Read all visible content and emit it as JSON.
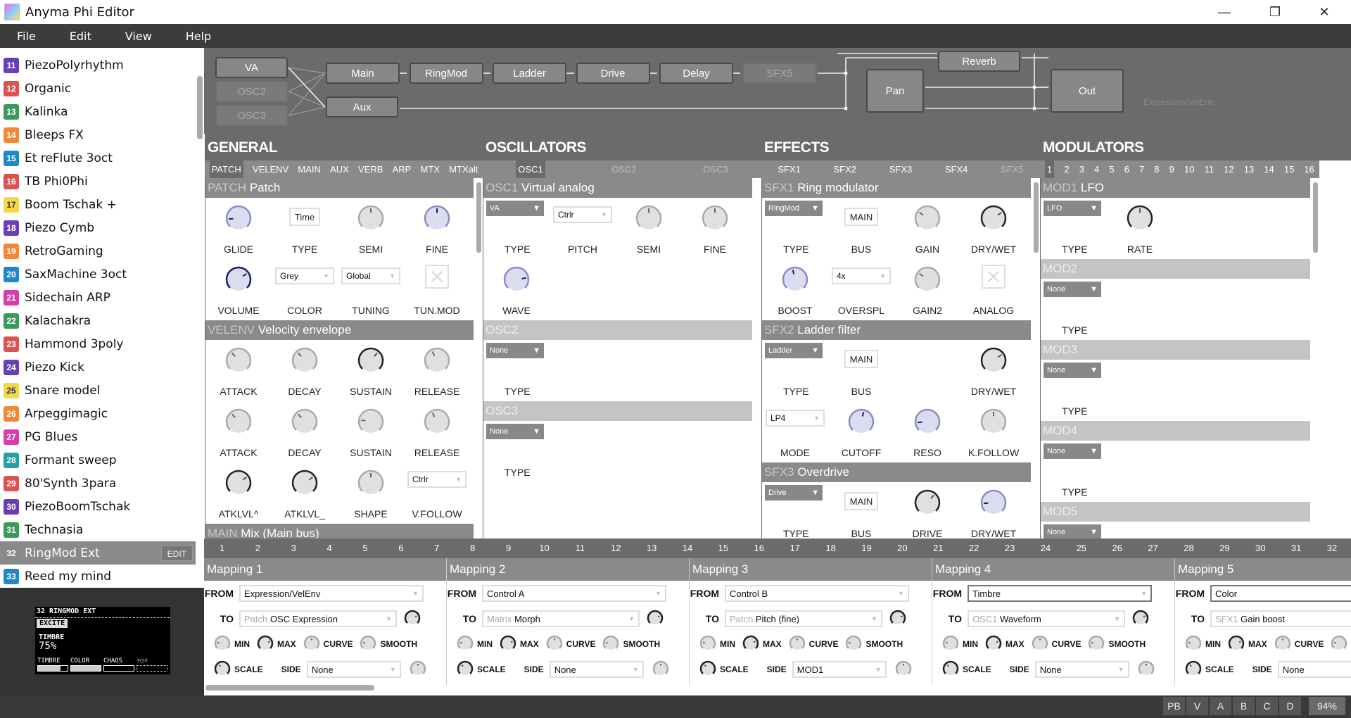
{
  "window": {
    "title": "Anyma Phi Editor",
    "controls": [
      "minimize-icon",
      "restore-icon",
      "close-icon"
    ]
  },
  "menu": [
    "File",
    "Edit",
    "View",
    "Help"
  ],
  "patches": [
    {
      "num": "11",
      "name": "PiezoPolyrhythm",
      "color": "#6a3fb5"
    },
    {
      "num": "12",
      "name": "Organic",
      "color": "#d9534f"
    },
    {
      "num": "13",
      "name": "Kalinka",
      "color": "#3a9a5b"
    },
    {
      "num": "14",
      "name": "Bleeps FX",
      "color": "#f0883a"
    },
    {
      "num": "15",
      "name": "Et reFlute 3oct",
      "color": "#1e88c8"
    },
    {
      "num": "16",
      "name": "TB Phi0Phi",
      "color": "#d9534f"
    },
    {
      "num": "17",
      "name": "Boom Tschak +",
      "color": "#f3d94a"
    },
    {
      "num": "18",
      "name": "Piezo Cymb",
      "color": "#6a3fb5"
    },
    {
      "num": "19",
      "name": "RetroGaming",
      "color": "#f0883a"
    },
    {
      "num": "20",
      "name": "SaxMachine 3oct",
      "color": "#1e88c8"
    },
    {
      "num": "21",
      "name": "Sidechain ARP",
      "color": "#d63fa8"
    },
    {
      "num": "22",
      "name": "Kalachakra",
      "color": "#3a9a5b"
    },
    {
      "num": "23",
      "name": "Hammond 3poly",
      "color": "#d9534f"
    },
    {
      "num": "24",
      "name": "Piezo Kick",
      "color": "#6a3fb5"
    },
    {
      "num": "25",
      "name": "Snare model",
      "color": "#f3d94a"
    },
    {
      "num": "26",
      "name": "Arpeggimagic",
      "color": "#f0883a"
    },
    {
      "num": "27",
      "name": "PG Blues",
      "color": "#d63fa8"
    },
    {
      "num": "28",
      "name": "Formant sweep",
      "color": "#24a0a6"
    },
    {
      "num": "29",
      "name": "80'Synth 3para",
      "color": "#d9534f"
    },
    {
      "num": "30",
      "name": "PiezoBoomTschak",
      "color": "#6a3fb5"
    },
    {
      "num": "31",
      "name": "Technasia",
      "color": "#3a9a5b"
    },
    {
      "num": "32",
      "name": "RingMod Ext",
      "color": "#888888",
      "selected": true,
      "edit": "EDIT"
    },
    {
      "num": "33",
      "name": "Reed my mind",
      "color": "#1e88c8"
    }
  ],
  "oled": {
    "patch": "32 RINGMOD EXT",
    "page": "EXCITE",
    "param": "TIMBRE",
    "value": "75%",
    "macros": [
      "TIMBRE",
      "COLOR",
      "CHAOS",
      "⚡○⚡"
    ],
    "macro_levels": [
      0.75,
      1.0,
      0,
      0
    ]
  },
  "status": {
    "buttons": [
      "PB",
      "V",
      "A",
      "B",
      "C",
      "D"
    ],
    "zoom": "94%"
  },
  "routing": {
    "sources": [
      {
        "label": "VA"
      },
      {
        "label": "OSC2",
        "dim": true
      },
      {
        "label": "OSC3",
        "dim": true
      }
    ],
    "chain": [
      {
        "label": "Main"
      },
      {
        "label": "RingMod"
      },
      {
        "label": "Ladder"
      },
      {
        "label": "Drive"
      },
      {
        "label": "Delay"
      },
      {
        "label": "SFX5",
        "dim": true
      }
    ],
    "aux": "Aux",
    "reverb": "Reverb",
    "pan": "Pan",
    "out": "Out",
    "hint": "Expression/VelEnv"
  },
  "columns": [
    {
      "title": "GENERAL",
      "tabs": [
        {
          "l": "PATCH",
          "active": true
        },
        {
          "l": "VELENV"
        },
        {
          "l": "MAIN"
        },
        {
          "l": "AUX"
        },
        {
          "l": "VERB"
        },
        {
          "l": "ARP"
        },
        {
          "l": "MTX"
        },
        {
          "l": "MTXalt"
        }
      ],
      "sections": [
        {
          "pre": "PATCH",
          "title": "Patch",
          "rows": [
            [
              {
                "t": "knob",
                "l": "GLIDE",
                "v": 0.15,
                "s": "blue"
              },
              {
                "t": "button",
                "l": "TYPE",
                "val": "Time"
              },
              {
                "t": "knob",
                "l": "SEMI",
                "v": 0.5
              },
              {
                "t": "knob",
                "l": "FINE",
                "v": 0.5,
                "s": "blue"
              }
            ],
            [
              {
                "t": "knob",
                "l": "VOLUME",
                "v": 0.7,
                "s": "navy"
              },
              {
                "t": "select",
                "l": "COLOR",
                "val": "Grey"
              },
              {
                "t": "select",
                "l": "TUNING",
                "val": "Global"
              },
              {
                "t": "check",
                "l": "TUN.MOD"
              }
            ]
          ]
        },
        {
          "pre": "VELENV",
          "title": "Velocity envelope",
          "rows": [
            [
              {
                "t": "knob",
                "l": "ATTACK",
                "v": 0.35
              },
              {
                "t": "knob",
                "l": "DECAY",
                "v": 0.35
              },
              {
                "t": "knob",
                "l": "SUSTAIN",
                "v": 0.65,
                "s": "dark"
              },
              {
                "t": "knob",
                "l": "RELEASE",
                "v": 0.4
              }
            ],
            [
              {
                "t": "knob",
                "l": "ATTACK",
                "v": 0.35
              },
              {
                "t": "knob",
                "l": "DECAY",
                "v": 0.35
              },
              {
                "t": "knob",
                "l": "SUSTAIN",
                "v": 0.2
              },
              {
                "t": "knob",
                "l": "RELEASE",
                "v": 0.4
              }
            ],
            [
              {
                "t": "knob",
                "l": "ATKLVL^",
                "v": 0.7,
                "s": "dark"
              },
              {
                "t": "knob",
                "l": "ATKLVL_",
                "v": 0.7,
                "s": "dark"
              },
              {
                "t": "knob",
                "l": "SHAPE",
                "v": 0.5
              },
              {
                "t": "select",
                "l": "V.FOLLOW",
                "val": "Ctrlr"
              }
            ]
          ]
        },
        {
          "pre": "MAIN",
          "title": "Mix (Main bus)",
          "rows": []
        }
      ]
    },
    {
      "title": "OSCILLATORS",
      "tabs": [
        {
          "l": "OSC1",
          "active": true
        },
        {
          "l": "OSC2",
          "dim": true
        },
        {
          "l": "OSC3",
          "dim": true
        }
      ],
      "sections": [
        {
          "pre": "OSC1",
          "title": "Virtual analog",
          "rows": [
            [
              {
                "t": "dsel",
                "l": "TYPE",
                "val": "VA"
              },
              {
                "t": "select",
                "l": "PITCH",
                "val": "Ctrlr"
              },
              {
                "t": "knob",
                "l": "SEMI",
                "v": 0.5
              },
              {
                "t": "knob",
                "l": "FINE",
                "v": 0.5
              }
            ],
            [
              {
                "t": "knob",
                "l": "WAVE",
                "v": 0.8,
                "s": "blue"
              }
            ]
          ]
        },
        {
          "pre": "OSC2",
          "title": "",
          "dim": true,
          "rows": [
            [
              {
                "t": "dsel",
                "l": "TYPE",
                "val": "None"
              }
            ]
          ]
        },
        {
          "pre": "OSC3",
          "title": "",
          "dim": true,
          "rows": [
            [
              {
                "t": "dsel",
                "l": "TYPE",
                "val": "None"
              }
            ]
          ]
        }
      ]
    },
    {
      "title": "EFFECTS",
      "tabs": [
        {
          "l": "SFX1"
        },
        {
          "l": "SFX2"
        },
        {
          "l": "SFX3"
        },
        {
          "l": "SFX4"
        },
        {
          "l": "SFX5",
          "dim": true
        }
      ],
      "sections": [
        {
          "pre": "SFX1",
          "title": "Ring modulator",
          "rows": [
            [
              {
                "t": "dsel",
                "l": "TYPE",
                "val": "RingMod"
              },
              {
                "t": "button",
                "l": "BUS",
                "val": "MAIN"
              },
              {
                "t": "knob",
                "l": "GAIN",
                "v": 0.3
              },
              {
                "t": "knob",
                "l": "DRY/WET",
                "v": 0.7,
                "s": "dark"
              }
            ],
            [
              {
                "t": "knob",
                "l": "BOOST",
                "v": 0.45,
                "s": "blue"
              },
              {
                "t": "select",
                "l": "OVERSPL",
                "val": "4x"
              },
              {
                "t": "knob",
                "l": "GAIN2",
                "v": 0.3
              },
              {
                "t": "check",
                "l": "ANALOG"
              }
            ]
          ]
        },
        {
          "pre": "SFX2",
          "title": "Ladder filter",
          "rows": [
            [
              {
                "t": "dsel",
                "l": "TYPE",
                "val": "Ladder"
              },
              {
                "t": "button",
                "l": "BUS",
                "val": "MAIN"
              },
              {
                "t": "empty"
              },
              {
                "t": "knob",
                "l": "DRY/WET",
                "v": 0.7,
                "s": "dark"
              }
            ],
            [
              {
                "t": "select",
                "l": "MODE",
                "val": "LP4"
              },
              {
                "t": "knob",
                "l": "CUTOFF",
                "v": 0.55,
                "s": "blue"
              },
              {
                "t": "knob",
                "l": "RESO",
                "v": 0.15,
                "s": "blue"
              },
              {
                "t": "knob",
                "l": "K.FOLLOW",
                "v": 0.5
              }
            ]
          ]
        },
        {
          "pre": "SFX3",
          "title": "Overdrive",
          "rows": [
            [
              {
                "t": "dsel",
                "l": "TYPE",
                "val": "Drive"
              },
              {
                "t": "button",
                "l": "BUS",
                "val": "MAIN"
              },
              {
                "t": "knob",
                "l": "DRIVE",
                "v": 0.65,
                "s": "dark"
              },
              {
                "t": "knob",
                "l": "DRY/WET",
                "v": 0.15,
                "s": "blue"
              }
            ]
          ]
        }
      ]
    },
    {
      "title": "MODULATORS",
      "tabs": [
        {
          "l": "1",
          "active": true
        },
        {
          "l": "2"
        },
        {
          "l": "3"
        },
        {
          "l": "4"
        },
        {
          "l": "5"
        },
        {
          "l": "6"
        },
        {
          "l": "7"
        },
        {
          "l": "8"
        },
        {
          "l": "9"
        },
        {
          "l": "10"
        },
        {
          "l": "11"
        },
        {
          "l": "12"
        },
        {
          "l": "13"
        },
        {
          "l": "14"
        },
        {
          "l": "15"
        },
        {
          "l": "16"
        }
      ],
      "sections": [
        {
          "pre": "MOD1",
          "title": "LFO",
          "rows": [
            [
              {
                "t": "dsel",
                "l": "TYPE",
                "val": "LFO"
              },
              {
                "t": "knob",
                "l": "RATE",
                "v": 0.5,
                "s": "dark"
              }
            ]
          ]
        },
        {
          "pre": "MOD2",
          "title": "",
          "dim": true,
          "rows": [
            [
              {
                "t": "dsel",
                "l": "TYPE",
                "val": "None"
              }
            ]
          ]
        },
        {
          "pre": "MOD3",
          "title": "",
          "dim": true,
          "rows": [
            [
              {
                "t": "dsel",
                "l": "TYPE",
                "val": "None"
              }
            ]
          ]
        },
        {
          "pre": "MOD4",
          "title": "",
          "dim": true,
          "rows": [
            [
              {
                "t": "dsel",
                "l": "TYPE",
                "val": "None"
              }
            ]
          ]
        },
        {
          "pre": "MOD5",
          "title": "",
          "dim": true,
          "rows": [
            [
              {
                "t": "dsel",
                "l": "TYPE",
                "val": "None"
              }
            ]
          ]
        }
      ]
    }
  ],
  "mapping_numbers": [
    "1",
    "2",
    "3",
    "4",
    "5",
    "6",
    "7",
    "8",
    "9",
    "10",
    "11",
    "12",
    "13",
    "14",
    "15",
    "16",
    "17",
    "18",
    "19",
    "20",
    "21",
    "22",
    "23",
    "24",
    "25",
    "26",
    "27",
    "28",
    "29",
    "30",
    "31",
    "32"
  ],
  "mapping_labels": {
    "from": "FROM",
    "to": "TO",
    "min": "MIN",
    "max": "MAX",
    "curve": "CURVE",
    "smooth": "SMOOTH",
    "scale": "SCALE",
    "side": "SIDE"
  },
  "mappings": [
    {
      "title": "Mapping 1",
      "from": "Expression/VelEnv",
      "to_pre": "Patch",
      "to": "OSC Expression",
      "side": "None"
    },
    {
      "title": "Mapping 2",
      "from": "Control A",
      "to_pre": "Matrix",
      "to": "Morph",
      "side": "None"
    },
    {
      "title": "Mapping 3",
      "from": "Control B",
      "to_pre": "Patch",
      "to": "Pitch (fine)",
      "side": "MOD1"
    },
    {
      "title": "Mapping 4",
      "from": "Timbre",
      "to_pre": "OSC1",
      "to": "Waveform",
      "side": "None",
      "focus": true
    },
    {
      "title": "Mapping 5",
      "from": "Color",
      "to_pre": "SFX1",
      "to": "Gain boost",
      "side": "None",
      "focus": true
    }
  ]
}
